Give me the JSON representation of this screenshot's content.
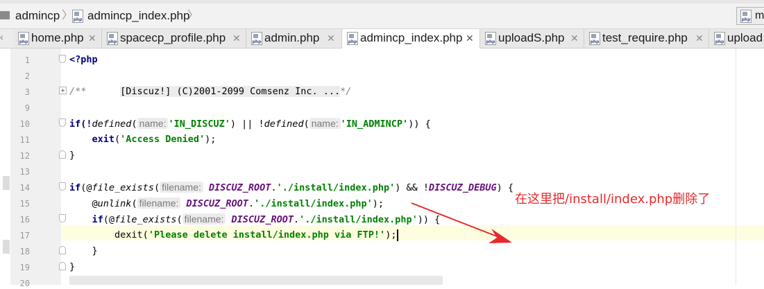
{
  "breadcrumb": {
    "items": [
      {
        "label": "admincp"
      },
      {
        "label": "admincp_index.php"
      }
    ]
  },
  "right_widget": {
    "label": "m"
  },
  "tabs": [
    {
      "label": "home.php"
    },
    {
      "label": "spacecp_profile.php"
    },
    {
      "label": "admin.php"
    },
    {
      "label": "admincp_index.php",
      "active": true
    },
    {
      "label": "uploadS.php"
    },
    {
      "label": "test_require.php"
    },
    {
      "label": "upload"
    }
  ],
  "file_icon_text": "php",
  "editor": {
    "line_numbers": [
      "1",
      "2",
      "3",
      "9",
      "10",
      "11",
      "12",
      "13",
      "14",
      "15",
      "16",
      "17",
      "18",
      "19",
      "20"
    ],
    "current_line": "17",
    "lines": {
      "l1": "<?php",
      "l3_open": "/**",
      "l3_fold": "[Discuz!] (C)2001-2099 Comsenz Inc. ...",
      "l3_close": "*/",
      "l10_a": "if(!",
      "l10_fn": "defined",
      "l10_b": "(",
      "l10_hint": "name:",
      "l10_str": "'IN_DISCUZ'",
      "l10_c": ") || !",
      "l10_fn2": "defined",
      "l10_d": "(",
      "l10_hint2": "name:",
      "l10_str2": "'IN_ADMINCP'",
      "l10_e": ")) {",
      "l11_kw": "exit",
      "l11_a": "(",
      "l11_str": "'Access Denied'",
      "l11_b": ");",
      "l12": "}",
      "l14_kw": "if",
      "l14_a": "(@",
      "l14_fn": "file_exists",
      "l14_b": "(",
      "l14_hint": "filename:",
      "l14_const": "DISCUZ_ROOT",
      "l14_dot": ".",
      "l14_str": "'./install/index.php'",
      "l14_c": ") && !",
      "l14_const2": "DISCUZ_DEBUG",
      "l14_d": ") {",
      "l15_a": "@",
      "l15_fn": "unlink",
      "l15_b": "(",
      "l15_hint": "filename:",
      "l15_const": "DISCUZ_ROOT",
      "l15_dot": ".",
      "l15_str": "'./install/index.php'",
      "l15_c": ");",
      "l16_kw": "if",
      "l16_a": "(@",
      "l16_fn": "file_exists",
      "l16_b": "(",
      "l16_hint": "filename:",
      "l16_const": "DISCUZ_ROOT",
      "l16_dot": ".",
      "l16_str": "'./install/index.php'",
      "l16_c": ")) {",
      "l17_a": "dexit(",
      "l17_str": "'Please delete install/index.php via FTP!'",
      "l17_b": ");",
      "l18": "}",
      "l19": "}"
    }
  },
  "annotation": {
    "text": "在这里把/install/index.php删除了",
    "color": "#e8282b"
  },
  "colors": {
    "keyword": "#000080",
    "string": "#008000",
    "constant": "#660e7a",
    "comment": "#808080",
    "current_line_bg": "#fffde0",
    "annotation": "#e8282b"
  }
}
